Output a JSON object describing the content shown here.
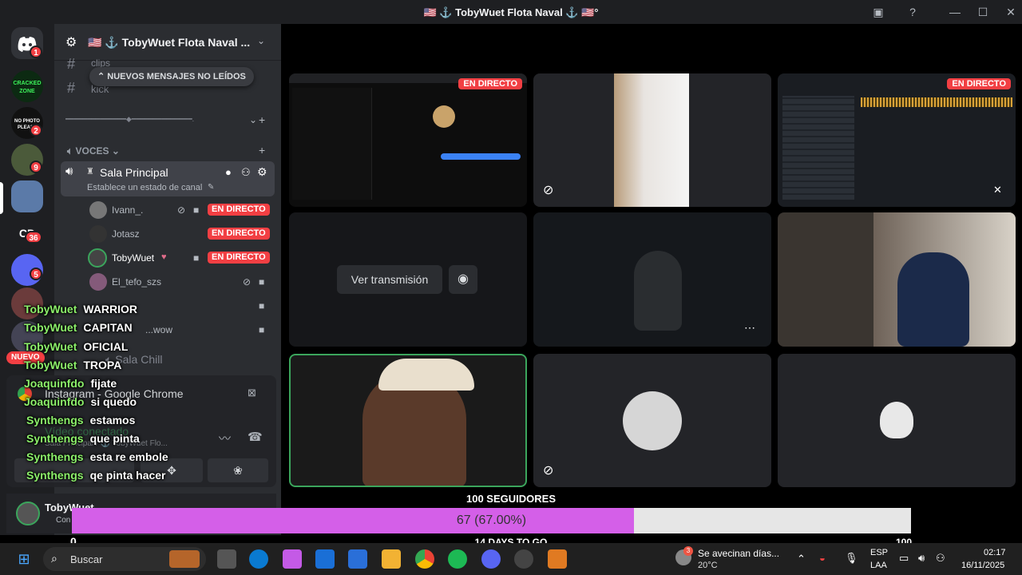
{
  "window": {
    "title": "🇺🇸 ⚓ TobyWuet Flota Naval ⚓ 🇺🇸°"
  },
  "servers": {
    "badges": [
      "1",
      "2",
      "9",
      "36",
      "5"
    ],
    "cracked_label": "CRACKED ZONE",
    "no_photo_label": "NO PHOTO PLEASE",
    "cd_label": "CD"
  },
  "sidebar": {
    "server_name": "🇺🇸 ⚓ TobyWuet Flota Naval ...",
    "channel_clips": "clips",
    "channel_kick": "kick",
    "unread_banner": "NUEVOS MENSAJES NO LEÍDOS",
    "divider": "━━━━━━━━━━━━━━◆━━━━━━━━━━━━━━.",
    "voice_category": "VOCES",
    "voice_channel": "Sala Principal",
    "voice_status": "Establece un estado de canal",
    "users": [
      {
        "name": "Ivann_."
      },
      {
        "name": "Jotasz"
      },
      {
        "name": "TobyWuet"
      },
      {
        "name": "El_tefo_szs"
      },
      {
        "name": "...wow"
      }
    ],
    "chill_channel": "Sala Chill",
    "new_badge": "NUEVO",
    "live_label": "EN DIRECTO"
  },
  "overlay": {
    "chrome_title": "Instagram - Google Chrome",
    "video_status": "Vídeo conectado",
    "video_sub": "Sala Principal / ⚓ TobyWuet Flo...",
    "account_name": "TobyWuet",
    "account_status": "Con"
  },
  "chat": [
    {
      "user": "TobyWuet",
      "msg": "WARRIOR"
    },
    {
      "user": "TobyWuet",
      "msg": "CAPITAN"
    },
    {
      "user": "TobyWuet",
      "msg": "OFICIAL"
    },
    {
      "user": "TobyWuet",
      "msg": "TROPA"
    },
    {
      "user": "Joaquinfdo",
      "msg": "fijate"
    },
    {
      "user": "Joaquinfdo",
      "msg": "si quedo"
    },
    {
      "user": "Synthengs",
      "msg": "estamos"
    },
    {
      "user": "Synthengs",
      "msg": "que pinta"
    },
    {
      "user": "Synthengs",
      "msg": "esta re embole"
    },
    {
      "user": "Synthengs",
      "msg": "qe pinta hacer"
    }
  ],
  "stage": {
    "live_label": "EN DIRECTO",
    "watch_button": "Ver transmisión"
  },
  "goal": {
    "title": "100 SEGUIDORES",
    "progress": 0.67,
    "progress_text": "67 (67.00%)",
    "min": "0",
    "max": "100",
    "days_left": "14 DAYS TO GO"
  },
  "taskbar": {
    "search_placeholder": "Buscar",
    "weather_text": "Se avecinan días...",
    "temperature": "20°C",
    "weather_badge": "3",
    "lang": "ESP",
    "lang_sub": "LAA",
    "time": "02:17",
    "date": "16/11/2025"
  },
  "colors": {
    "live": "#f23f43",
    "goal_fill": "#d45fe8",
    "chat_user": "#8cf06a",
    "speaking": "#3ba55c"
  }
}
